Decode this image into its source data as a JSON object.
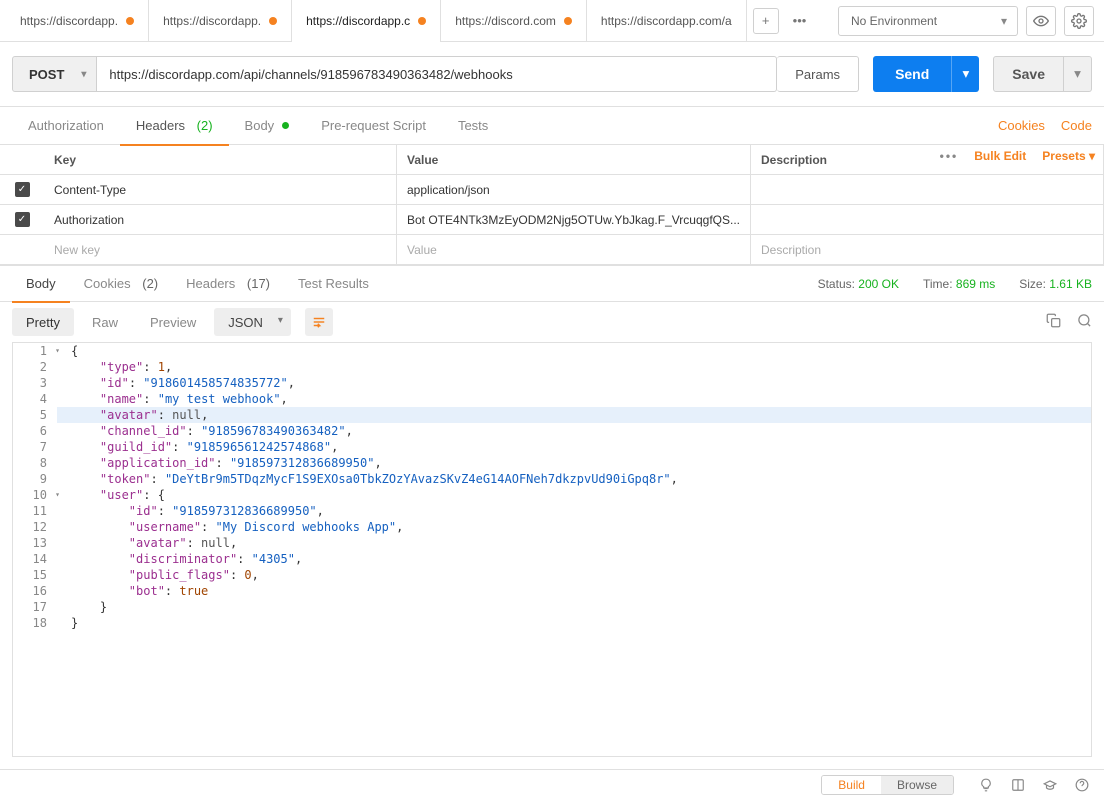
{
  "topbar": {
    "tabs": [
      {
        "label": "https://discordapp.",
        "dirty": true
      },
      {
        "label": "https://discordapp.",
        "dirty": true
      },
      {
        "label": "https://discordapp.c",
        "dirty": true,
        "active": true
      },
      {
        "label": "https://discord.com",
        "dirty": true
      },
      {
        "label": "https://discordapp.com/a",
        "dirty": false
      }
    ],
    "env_label": "No Environment"
  },
  "request": {
    "method": "POST",
    "url": "https://discordapp.com/api/channels/918596783490363482/webhooks",
    "params_btn": "Params",
    "send_btn": "Send",
    "save_btn": "Save"
  },
  "subtabs": {
    "auth": "Authorization",
    "headers_label": "Headers",
    "headers_count": "(2)",
    "body": "Body",
    "prerequest": "Pre-request Script",
    "tests": "Tests",
    "cookies": "Cookies",
    "code": "Code"
  },
  "headers_table": {
    "col_key": "Key",
    "col_value": "Value",
    "col_desc": "Description",
    "bulk": "Bulk Edit",
    "presets": "Presets",
    "rows": [
      {
        "key": "Content-Type",
        "value": "application/json"
      },
      {
        "key": "Authorization",
        "value": "Bot OTE4NTk3MzEyODM2Njg5OTUw.YbJkag.F_VrcuqgfQS..."
      }
    ],
    "placeholder_key": "New key",
    "placeholder_value": "Value",
    "placeholder_desc": "Description"
  },
  "response": {
    "body": "Body",
    "cookies_label": "Cookies",
    "cookies_count": "(2)",
    "headers_label": "Headers",
    "headers_count": "(17)",
    "tests": "Test Results",
    "status_label": "Status:",
    "status_value": "200 OK",
    "time_label": "Time:",
    "time_value": "869 ms",
    "size_label": "Size:",
    "size_value": "1.61 KB"
  },
  "view": {
    "pretty": "Pretty",
    "raw": "Raw",
    "preview": "Preview",
    "format": "JSON"
  },
  "json_body": {
    "type": 1,
    "id": "918601458574835772",
    "name": "my test webhook",
    "avatar": null,
    "channel_id": "918596783490363482",
    "guild_id": "918596561242574868",
    "application_id": "918597312836689950",
    "token": "DeYtBr9m5TDqzMycF1S9EXOsa0TbkZOzYAvazSKvZ4eG14AOFNeh7dkzpvUd90iGpq8r",
    "user": {
      "id": "918597312836689950",
      "username": "My Discord webhooks App",
      "avatar": null,
      "discriminator": "4305",
      "public_flags": 0,
      "bot": true
    }
  },
  "highlight_line": 5,
  "bottombar": {
    "build": "Build",
    "browse": "Browse"
  }
}
